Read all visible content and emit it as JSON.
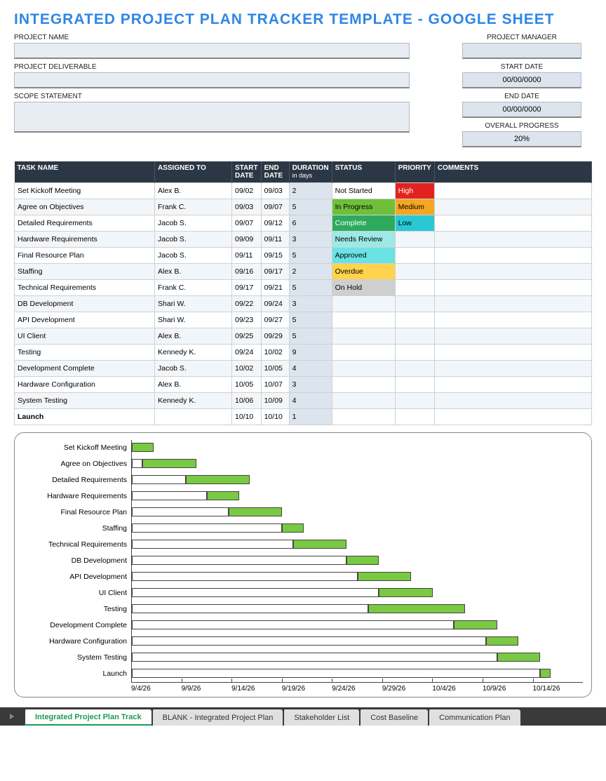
{
  "title": "INTEGRATED PROJECT PLAN TRACKER TEMPLATE - GOOGLE SHEET",
  "fields": {
    "projectName": {
      "label": "PROJECT NAME",
      "value": ""
    },
    "projectDeliverable": {
      "label": "PROJECT DELIVERABLE",
      "value": ""
    },
    "scopeStatement": {
      "label": "SCOPE STATEMENT",
      "value": ""
    },
    "projectManager": {
      "label": "PROJECT MANAGER",
      "value": ""
    },
    "startDate": {
      "label": "START DATE",
      "value": "00/00/0000"
    },
    "endDate": {
      "label": "END DATE",
      "value": "00/00/0000"
    },
    "overallProgress": {
      "label": "OVERALL PROGRESS",
      "value": "20%"
    }
  },
  "columns": {
    "task": "TASK NAME",
    "assigned": "ASSIGNED TO",
    "start": "START DATE",
    "end": "END DATE",
    "duration": "DURATION",
    "durationSub": "in days",
    "status": "STATUS",
    "priority": "PRIORITY",
    "comments": "COMMENTS"
  },
  "rows": [
    {
      "task": "Set Kickoff Meeting",
      "assigned": "Alex B.",
      "start": "09/02",
      "end": "09/03",
      "duration": "2",
      "status": "Not Started",
      "statusClass": "st-notstarted",
      "priority": "High",
      "priorityClass": "pr-high"
    },
    {
      "task": "Agree on Objectives",
      "assigned": "Frank C.",
      "start": "09/03",
      "end": "09/07",
      "duration": "5",
      "status": "In Progress",
      "statusClass": "st-inprogress",
      "priority": "Medium",
      "priorityClass": "pr-medium"
    },
    {
      "task": "Detailed Requirements",
      "assigned": "Jacob S.",
      "start": "09/07",
      "end": "09/12",
      "duration": "6",
      "status": "Complete",
      "statusClass": "st-complete",
      "priority": "Low",
      "priorityClass": "pr-low"
    },
    {
      "task": "Hardware Requirements",
      "assigned": "Jacob S.",
      "start": "09/09",
      "end": "09/11",
      "duration": "3",
      "status": "Needs Review",
      "statusClass": "st-needsreview",
      "priority": "",
      "priorityClass": ""
    },
    {
      "task": "Final Resource Plan",
      "assigned": "Jacob S.",
      "start": "09/11",
      "end": "09/15",
      "duration": "5",
      "status": "Approved",
      "statusClass": "st-approved",
      "priority": "",
      "priorityClass": ""
    },
    {
      "task": "Staffing",
      "assigned": "Alex B.",
      "start": "09/16",
      "end": "09/17",
      "duration": "2",
      "status": "Overdue",
      "statusClass": "st-overdue",
      "priority": "",
      "priorityClass": ""
    },
    {
      "task": "Technical Requirements",
      "assigned": "Frank C.",
      "start": "09/17",
      "end": "09/21",
      "duration": "5",
      "status": "On Hold",
      "statusClass": "st-onhold",
      "priority": "",
      "priorityClass": ""
    },
    {
      "task": "DB Development",
      "assigned": "Shari W.",
      "start": "09/22",
      "end": "09/24",
      "duration": "3",
      "status": "",
      "statusClass": "",
      "priority": "",
      "priorityClass": ""
    },
    {
      "task": "API Development",
      "assigned": "Shari W.",
      "start": "09/23",
      "end": "09/27",
      "duration": "5",
      "status": "",
      "statusClass": "",
      "priority": "",
      "priorityClass": ""
    },
    {
      "task": "UI Client",
      "assigned": "Alex B.",
      "start": "09/25",
      "end": "09/29",
      "duration": "5",
      "status": "",
      "statusClass": "",
      "priority": "",
      "priorityClass": ""
    },
    {
      "task": "Testing",
      "assigned": "Kennedy K.",
      "start": "09/24",
      "end": "10/02",
      "duration": "9",
      "status": "",
      "statusClass": "",
      "priority": "",
      "priorityClass": ""
    },
    {
      "task": "Development Complete",
      "assigned": "Jacob S.",
      "start": "10/02",
      "end": "10/05",
      "duration": "4",
      "status": "",
      "statusClass": "",
      "priority": "",
      "priorityClass": ""
    },
    {
      "task": "Hardware Configuration",
      "assigned": "Alex B.",
      "start": "10/05",
      "end": "10/07",
      "duration": "3",
      "status": "",
      "statusClass": "",
      "priority": "",
      "priorityClass": ""
    },
    {
      "task": "System Testing",
      "assigned": "Kennedy K.",
      "start": "10/06",
      "end": "10/09",
      "duration": "4",
      "status": "",
      "statusClass": "",
      "priority": "",
      "priorityClass": ""
    },
    {
      "task": "Launch",
      "assigned": "",
      "start": "10/10",
      "end": "10/10",
      "duration": "1",
      "status": "",
      "statusClass": "",
      "priority": "",
      "priorityClass": "",
      "bold": true
    }
  ],
  "chart_data": {
    "type": "bar",
    "orientation": "horizontal-gantt",
    "xlabel": "",
    "ylabel": "",
    "x_axis_ticks": [
      "9/4/26",
      "9/9/26",
      "9/14/26",
      "9/19/26",
      "9/24/26",
      "9/29/26",
      "10/4/26",
      "10/9/26",
      "10/14/26"
    ],
    "domain_days": {
      "start": 2,
      "end": 44
    },
    "tasks": [
      {
        "name": "Set Kickoff Meeting",
        "startDay": 2,
        "duration": 2
      },
      {
        "name": "Agree on Objectives",
        "startDay": 3,
        "duration": 5
      },
      {
        "name": "Detailed Requirements",
        "startDay": 7,
        "duration": 6
      },
      {
        "name": "Hardware Requirements",
        "startDay": 9,
        "duration": 3
      },
      {
        "name": "Final Resource Plan",
        "startDay": 11,
        "duration": 5
      },
      {
        "name": "Staffing",
        "startDay": 16,
        "duration": 2
      },
      {
        "name": "Technical Requirements",
        "startDay": 17,
        "duration": 5
      },
      {
        "name": "DB Development",
        "startDay": 22,
        "duration": 3
      },
      {
        "name": "API Development",
        "startDay": 23,
        "duration": 5
      },
      {
        "name": "UI Client",
        "startDay": 25,
        "duration": 5
      },
      {
        "name": "Testing",
        "startDay": 24,
        "duration": 9
      },
      {
        "name": "Development Complete",
        "startDay": 32,
        "duration": 4
      },
      {
        "name": "Hardware Configuration",
        "startDay": 35,
        "duration": 3
      },
      {
        "name": "System Testing",
        "startDay": 36,
        "duration": 4
      },
      {
        "name": "Launch",
        "startDay": 40,
        "duration": 1
      }
    ]
  },
  "tabs": [
    {
      "label": "Integrated Project Plan Track",
      "active": true
    },
    {
      "label": "BLANK - Integrated Project Plan",
      "active": false
    },
    {
      "label": "Stakeholder List",
      "active": false
    },
    {
      "label": "Cost Baseline",
      "active": false
    },
    {
      "label": "Communication Plan",
      "active": false
    }
  ]
}
